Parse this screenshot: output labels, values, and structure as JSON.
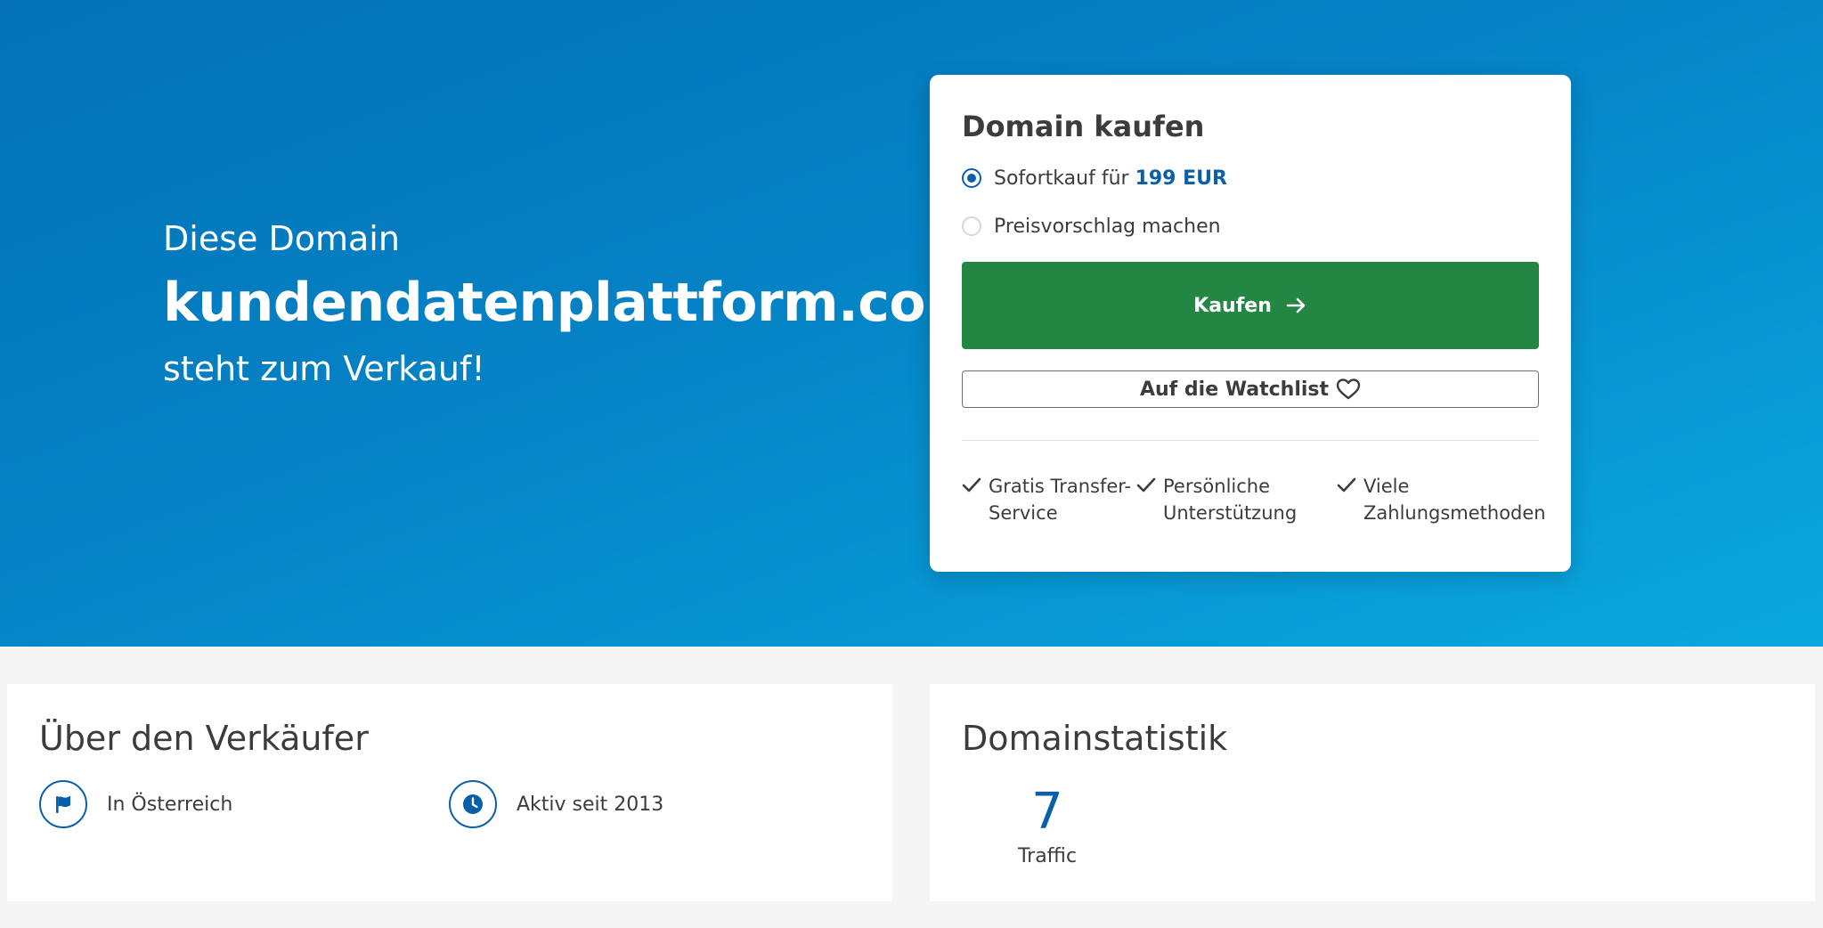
{
  "hero": {
    "pre": "Diese Domain",
    "domain": "kundendatenplattform.com",
    "post": "steht zum Verkauf!"
  },
  "buy": {
    "title": "Domain kaufen",
    "options": [
      {
        "label": "Sofortkauf für",
        "price": "199 EUR",
        "selected": true
      },
      {
        "label": "Preisvorschlag machen",
        "selected": false
      }
    ],
    "buy_button": "Kaufen",
    "watchlist_button": "Auf die Watchlist",
    "features": [
      {
        "line1": "Gratis Transfer-",
        "line2": "Service"
      },
      {
        "line1": "Persönliche",
        "line2": "Unterstützung"
      },
      {
        "line1": "Viele",
        "line2": "Zahlungsmethoden"
      }
    ]
  },
  "seller": {
    "title": "Über den Verkäufer",
    "location": "In Österreich",
    "active": "Aktiv seit 2013"
  },
  "stats": {
    "title": "Domainstatistik",
    "traffic_value": "7",
    "traffic_label": "Traffic"
  },
  "colors": {
    "accent": "#0b5ea8",
    "buy_green": "#238743",
    "hero_start": "#0471b7",
    "hero_end": "#0aa8df"
  },
  "icons": {
    "buy_arrow": "arrow-right-icon",
    "watchlist": "heart-icon",
    "feature": "check-icon",
    "location": "flag-icon",
    "active": "clock-icon"
  }
}
